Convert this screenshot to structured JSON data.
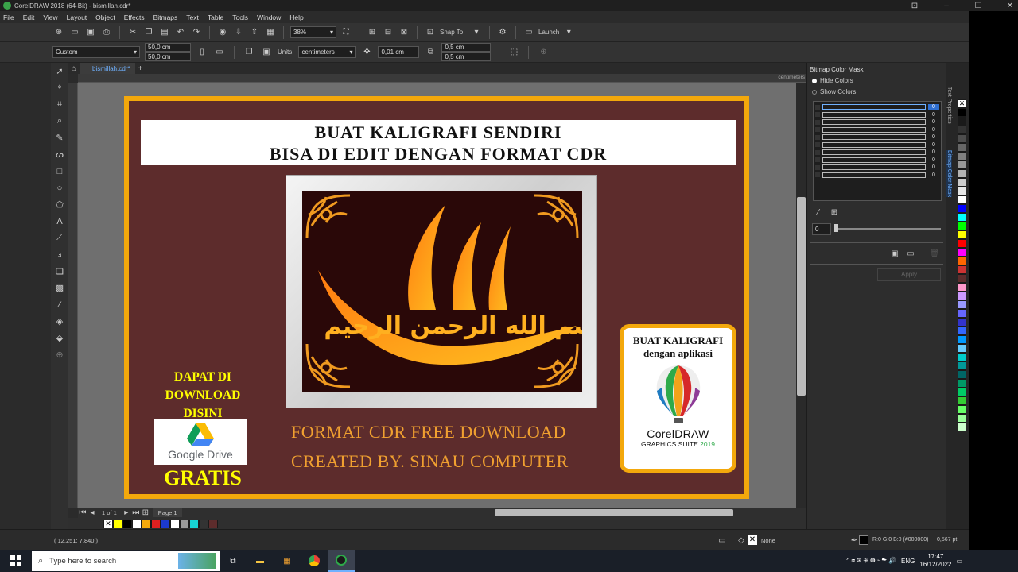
{
  "window": {
    "title": "CorelDRAW 2018 (64-Bit) - bismillah.cdr*"
  },
  "menu": [
    "File",
    "Edit",
    "View",
    "Layout",
    "Object",
    "Effects",
    "Bitmaps",
    "Text",
    "Table",
    "Tools",
    "Window",
    "Help"
  ],
  "toolbar": {
    "zoom": "38%",
    "snap_to": "Snap To",
    "launch": "Launch"
  },
  "propbar": {
    "preset": "Custom",
    "width": "50,0 cm",
    "height": "50,0 cm",
    "units_label": "Units:",
    "units": "centimeters",
    "nudge": "0,01 cm",
    "dup_x": "0,5 cm",
    "dup_y": "0,5 cm"
  },
  "doc": {
    "tab": "bismillah.cdr*",
    "ruler_units": "centimeters",
    "page_count": "1 of 1",
    "page_tab": "Page 1"
  },
  "artwork": {
    "title_line1": "BUAT KALIGRAFI SENDIRI",
    "title_line2": "BISA DI EDIT DENGAN FORMAT CDR",
    "download_text": "DAPAT DI DOWNLOAD DISINI",
    "gdrive_label": "Google Drive",
    "gratis": "GRATIS",
    "format_line": "FORMAT CDR FREE DOWNLOAD",
    "created_line": "CREATED BY. SINAU COMPUTER",
    "corel_head1": "BUAT KALIGRAFI",
    "corel_head2": "dengan aplikasi",
    "corel_brand": "CorelDRAW",
    "corel_suite": "GRAPHICS SUITE",
    "corel_year": "2019",
    "calligraphy_text": "بسم الله الرحمن الرحيم"
  },
  "docker": {
    "title": "Bitmap Color Mask",
    "hide_colors": "Hide Colors",
    "show_colors": "Show Colors",
    "tolerance_values": [
      "0",
      "0",
      "0",
      "0",
      "0",
      "0",
      "0",
      "0",
      "0",
      "0"
    ],
    "slider_value": "0",
    "apply": "Apply",
    "side_tabs": [
      "Text Properties",
      "Bitmap Color Mask"
    ]
  },
  "status": {
    "coords": "( 12,251; 7,840 )",
    "outline_none": "None",
    "fill_info": "R:0 G:0 B:0 (#000000)",
    "outline_width": "0,567 pt"
  },
  "taskbar": {
    "search_placeholder": "Type here to search",
    "lang": "ENG",
    "time": "17:47",
    "date": "16/12/2022"
  },
  "colors": {
    "accent_orange": "#f3a80c",
    "board_brown": "#5d2c2c",
    "text_gold": "#f0a030",
    "text_yellow": "#ffff00"
  }
}
